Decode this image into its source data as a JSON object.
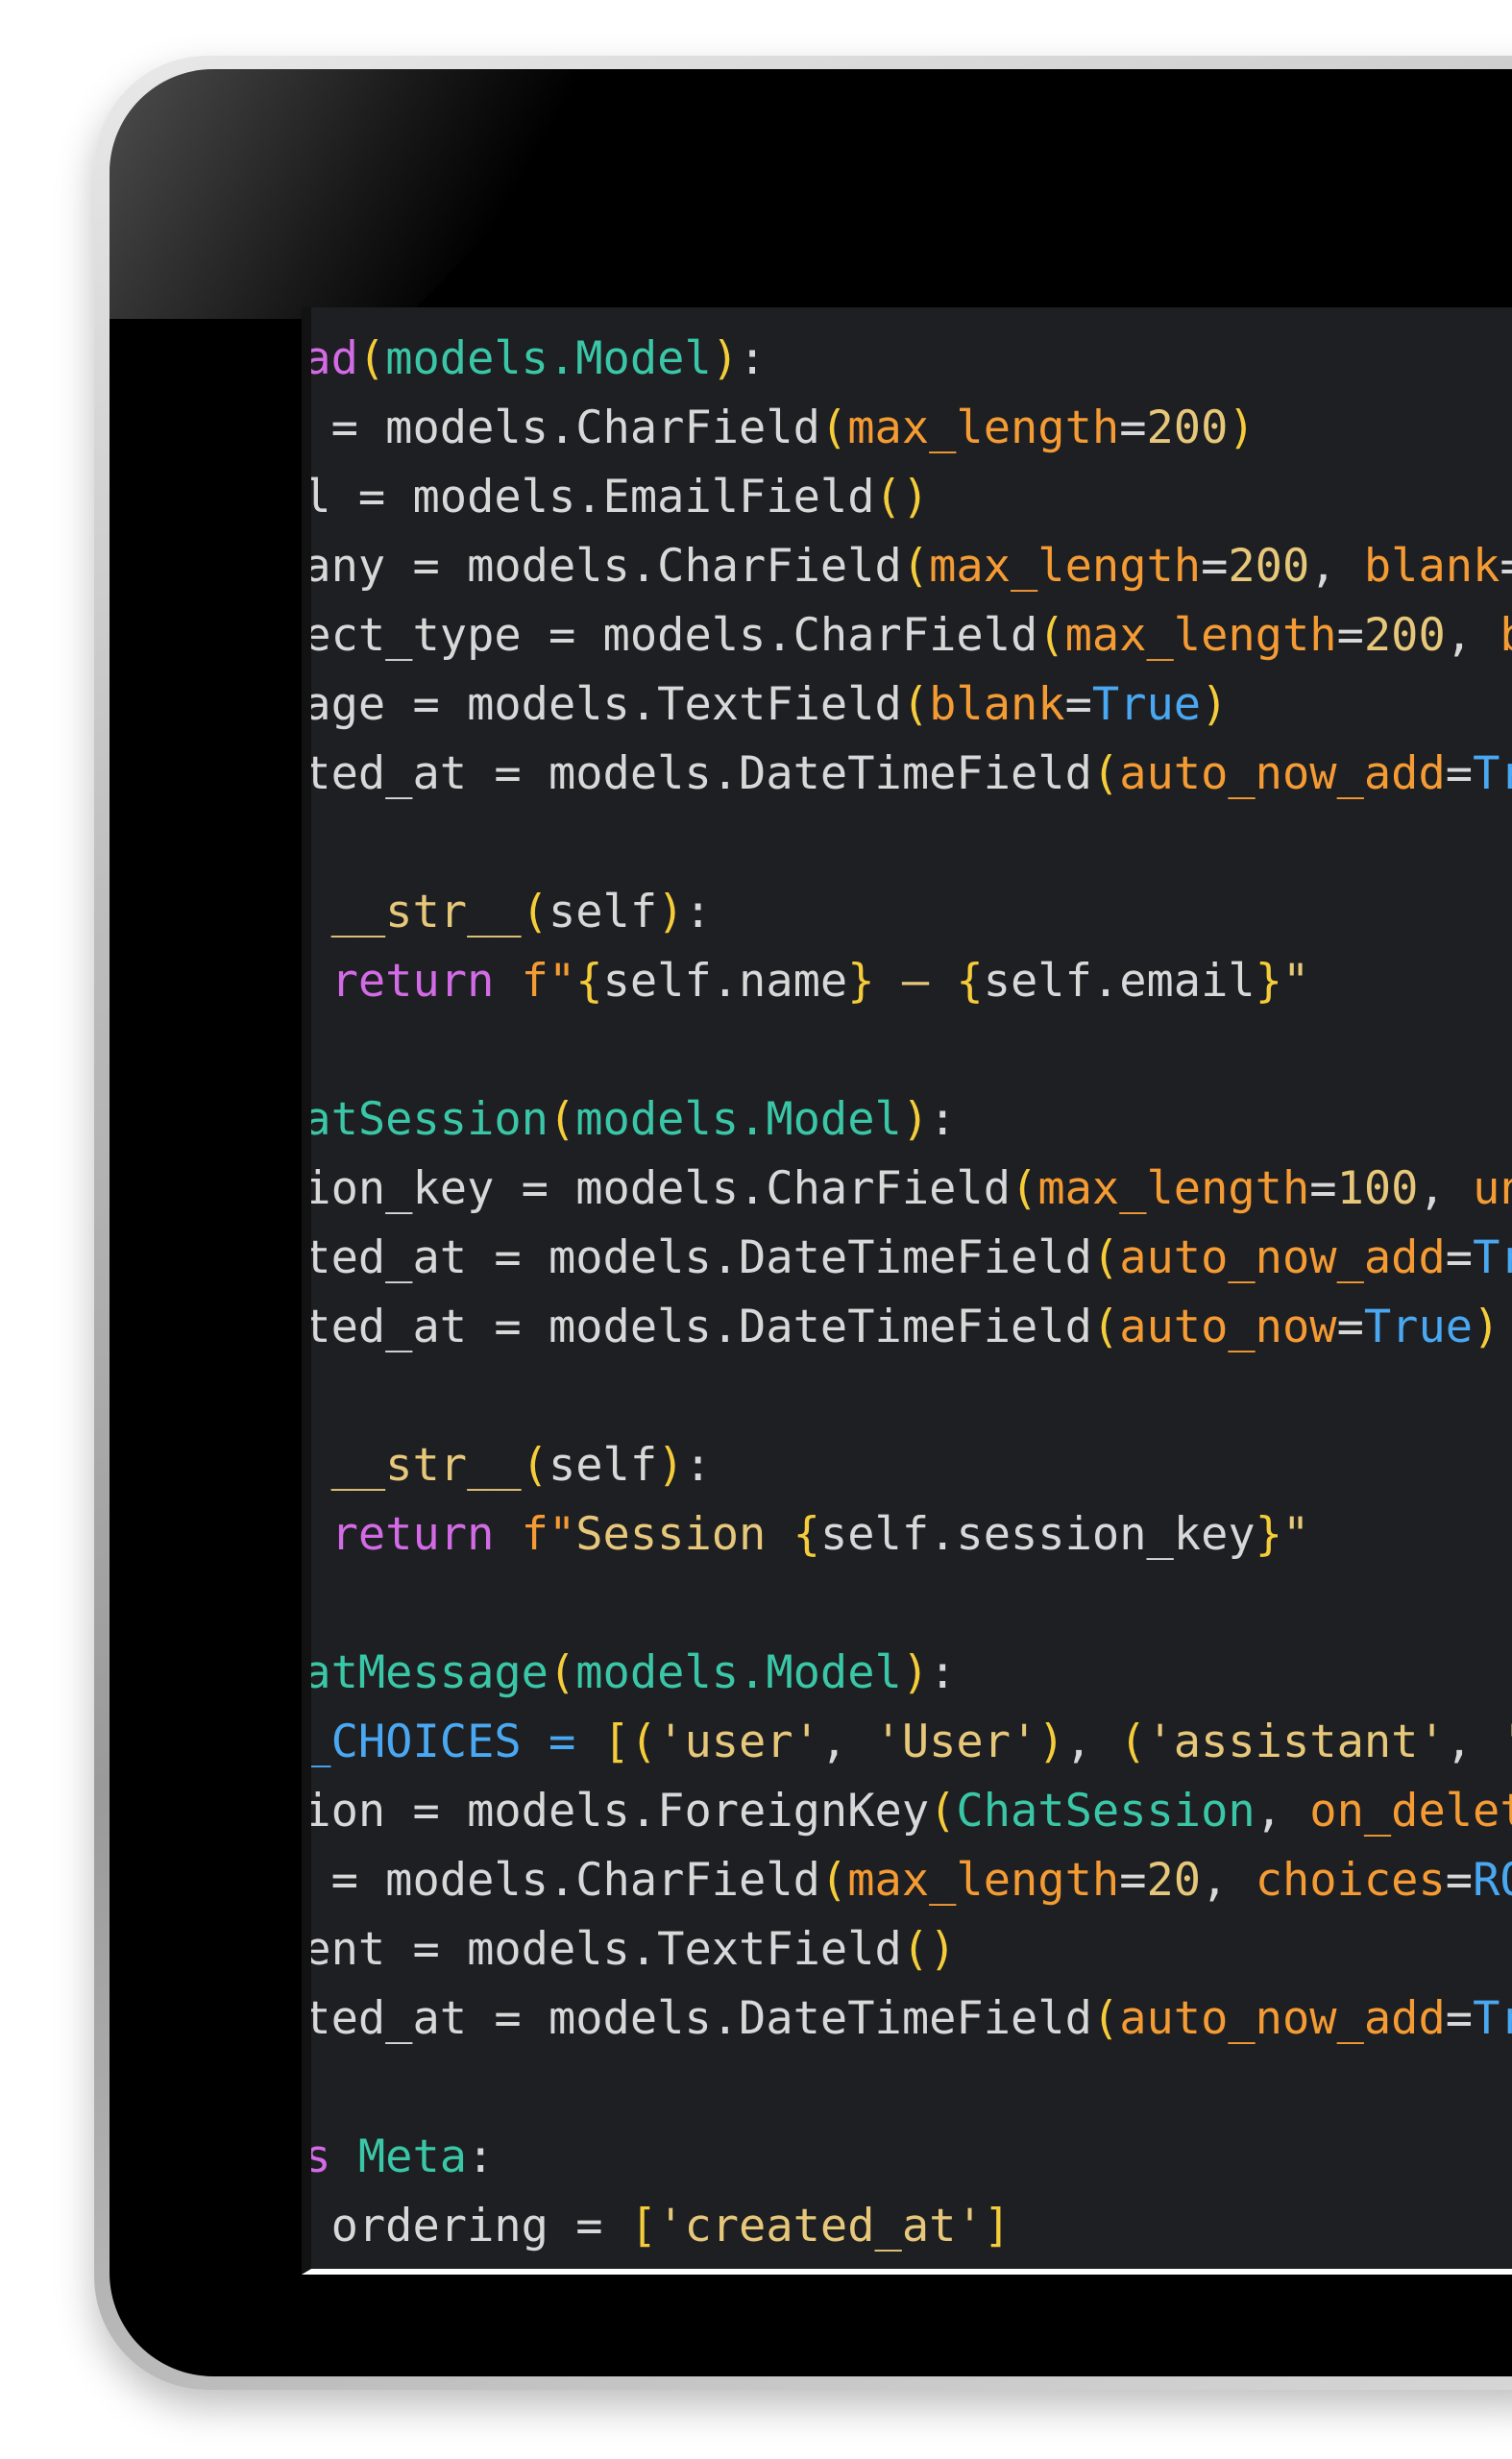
{
  "editor": {
    "code_lines": [
      [
        {
          "t": "ead",
          "c": "kw"
        },
        {
          "t": "(",
          "c": "br"
        },
        {
          "t": "models.Model",
          "c": "ty"
        },
        {
          "t": ")",
          "c": "br"
        },
        {
          "t": ":",
          "c": "op"
        }
      ],
      [
        {
          "t": "e = models.CharField",
          "c": "id"
        },
        {
          "t": "(",
          "c": "br"
        },
        {
          "t": "max_length",
          "c": "arg"
        },
        {
          "t": "=",
          "c": "op"
        },
        {
          "t": "200",
          "c": "str"
        },
        {
          "t": ")",
          "c": "br"
        }
      ],
      [
        {
          "t": "il = models.EmailField",
          "c": "id"
        },
        {
          "t": "()",
          "c": "br"
        }
      ],
      [
        {
          "t": "pany = models.CharField",
          "c": "id"
        },
        {
          "t": "(",
          "c": "br"
        },
        {
          "t": "max_length",
          "c": "arg"
        },
        {
          "t": "=",
          "c": "op"
        },
        {
          "t": "200",
          "c": "str"
        },
        {
          "t": ", ",
          "c": "op"
        },
        {
          "t": "blank",
          "c": "arg"
        },
        {
          "t": "=",
          "c": "op"
        },
        {
          "t": "Tr",
          "c": "val"
        }
      ],
      [
        {
          "t": "ject_type = models.CharField",
          "c": "id"
        },
        {
          "t": "(",
          "c": "br"
        },
        {
          "t": "max_length",
          "c": "arg"
        },
        {
          "t": "=",
          "c": "op"
        },
        {
          "t": "200",
          "c": "str"
        },
        {
          "t": ", ",
          "c": "op"
        },
        {
          "t": "bla",
          "c": "arg"
        }
      ],
      [
        {
          "t": "sage = models.TextField",
          "c": "id"
        },
        {
          "t": "(",
          "c": "br"
        },
        {
          "t": "blank",
          "c": "arg"
        },
        {
          "t": "=",
          "c": "op"
        },
        {
          "t": "True",
          "c": "val"
        },
        {
          "t": ")",
          "c": "br"
        }
      ],
      [
        {
          "t": "ated_at = models.DateTimeField",
          "c": "id"
        },
        {
          "t": "(",
          "c": "br"
        },
        {
          "t": "auto_now_add",
          "c": "arg"
        },
        {
          "t": "=",
          "c": "op"
        },
        {
          "t": "True",
          "c": "val"
        }
      ],
      [],
      [
        {
          "t": "  __str__",
          "c": "str"
        },
        {
          "t": "(",
          "c": "br"
        },
        {
          "t": "self",
          "c": "id"
        },
        {
          "t": ")",
          "c": "br"
        },
        {
          "t": ":",
          "c": "op"
        }
      ],
      [
        {
          "t": "  return ",
          "c": "kw"
        },
        {
          "t": "f\"",
          "c": "arg"
        },
        {
          "t": "{",
          "c": "br"
        },
        {
          "t": "self.name",
          "c": "id"
        },
        {
          "t": "}",
          "c": "br"
        },
        {
          "t": " — ",
          "c": "str"
        },
        {
          "t": "{",
          "c": "br"
        },
        {
          "t": "self.email",
          "c": "id"
        },
        {
          "t": "}",
          "c": "br"
        },
        {
          "t": "\"",
          "c": "str"
        }
      ],
      [],
      [
        {
          "t": "hatSession",
          "c": "ty"
        },
        {
          "t": "(",
          "c": "br"
        },
        {
          "t": "models.Model",
          "c": "ty"
        },
        {
          "t": ")",
          "c": "br"
        },
        {
          "t": ":",
          "c": "op"
        }
      ],
      [
        {
          "t": "sion_key = models.CharField",
          "c": "id"
        },
        {
          "t": "(",
          "c": "br"
        },
        {
          "t": "max_length",
          "c": "arg"
        },
        {
          "t": "=",
          "c": "op"
        },
        {
          "t": "100",
          "c": "str"
        },
        {
          "t": ", ",
          "c": "op"
        },
        {
          "t": "uni",
          "c": "arg"
        }
      ],
      [
        {
          "t": "ated_at = models.DateTimeField",
          "c": "id"
        },
        {
          "t": "(",
          "c": "br"
        },
        {
          "t": "auto_now_add",
          "c": "arg"
        },
        {
          "t": "=",
          "c": "op"
        },
        {
          "t": "True",
          "c": "val"
        }
      ],
      [
        {
          "t": "ated_at = models.DateTimeField",
          "c": "id"
        },
        {
          "t": "(",
          "c": "br"
        },
        {
          "t": "auto_now",
          "c": "arg"
        },
        {
          "t": "=",
          "c": "op"
        },
        {
          "t": "True",
          "c": "val"
        },
        {
          "t": ")",
          "c": "br"
        }
      ],
      [],
      [
        {
          "t": "  __str__",
          "c": "str"
        },
        {
          "t": "(",
          "c": "br"
        },
        {
          "t": "self",
          "c": "id"
        },
        {
          "t": ")",
          "c": "br"
        },
        {
          "t": ":",
          "c": "op"
        }
      ],
      [
        {
          "t": "  return ",
          "c": "kw"
        },
        {
          "t": "f\"",
          "c": "arg"
        },
        {
          "t": "Session ",
          "c": "str"
        },
        {
          "t": "{",
          "c": "br"
        },
        {
          "t": "self.session_key",
          "c": "id"
        },
        {
          "t": "}",
          "c": "br"
        },
        {
          "t": "\"",
          "c": "str"
        }
      ],
      [],
      [
        {
          "t": "hatMessage",
          "c": "ty"
        },
        {
          "t": "(",
          "c": "br"
        },
        {
          "t": "models.Model",
          "c": "ty"
        },
        {
          "t": ")",
          "c": "br"
        },
        {
          "t": ":",
          "c": "op"
        }
      ],
      [
        {
          "t": "E_CHOICES = ",
          "c": "val"
        },
        {
          "t": "[(",
          "c": "br"
        },
        {
          "t": "'user'",
          "c": "str"
        },
        {
          "t": ", ",
          "c": "op"
        },
        {
          "t": "'User'",
          "c": "str"
        },
        {
          "t": ")",
          "c": "br"
        },
        {
          "t": ", ",
          "c": "op"
        },
        {
          "t": "(",
          "c": "br"
        },
        {
          "t": "'assistant'",
          "c": "str"
        },
        {
          "t": ", ",
          "c": "op"
        },
        {
          "t": "'As",
          "c": "str"
        }
      ],
      [
        {
          "t": "sion = models.ForeignKey",
          "c": "id"
        },
        {
          "t": "(",
          "c": "br"
        },
        {
          "t": "ChatSession",
          "c": "ty"
        },
        {
          "t": ", ",
          "c": "op"
        },
        {
          "t": "on_delete",
          "c": "arg"
        },
        {
          "t": "=",
          "c": "op"
        }
      ],
      [
        {
          "t": "e = models.CharField",
          "c": "id"
        },
        {
          "t": "(",
          "c": "br"
        },
        {
          "t": "max_length",
          "c": "arg"
        },
        {
          "t": "=",
          "c": "op"
        },
        {
          "t": "20",
          "c": "str"
        },
        {
          "t": ", ",
          "c": "op"
        },
        {
          "t": "choices",
          "c": "arg"
        },
        {
          "t": "=",
          "c": "op"
        },
        {
          "t": "ROLE",
          "c": "val"
        }
      ],
      [
        {
          "t": "tent = models.TextField",
          "c": "id"
        },
        {
          "t": "()",
          "c": "br"
        }
      ],
      [
        {
          "t": "ated_at = models.DateTimeField",
          "c": "id"
        },
        {
          "t": "(",
          "c": "br"
        },
        {
          "t": "auto_now_add",
          "c": "arg"
        },
        {
          "t": "=",
          "c": "op"
        },
        {
          "t": "True",
          "c": "val"
        }
      ],
      [],
      [
        {
          "t": "ss ",
          "c": "kw"
        },
        {
          "t": "Meta",
          "c": "ty"
        },
        {
          "t": ":",
          "c": "op"
        }
      ],
      [
        {
          "t": "  ordering = ",
          "c": "id"
        },
        {
          "t": "[",
          "c": "br"
        },
        {
          "t": "'created_at'",
          "c": "str"
        },
        {
          "t": "]",
          "c": "br"
        }
      ]
    ]
  }
}
